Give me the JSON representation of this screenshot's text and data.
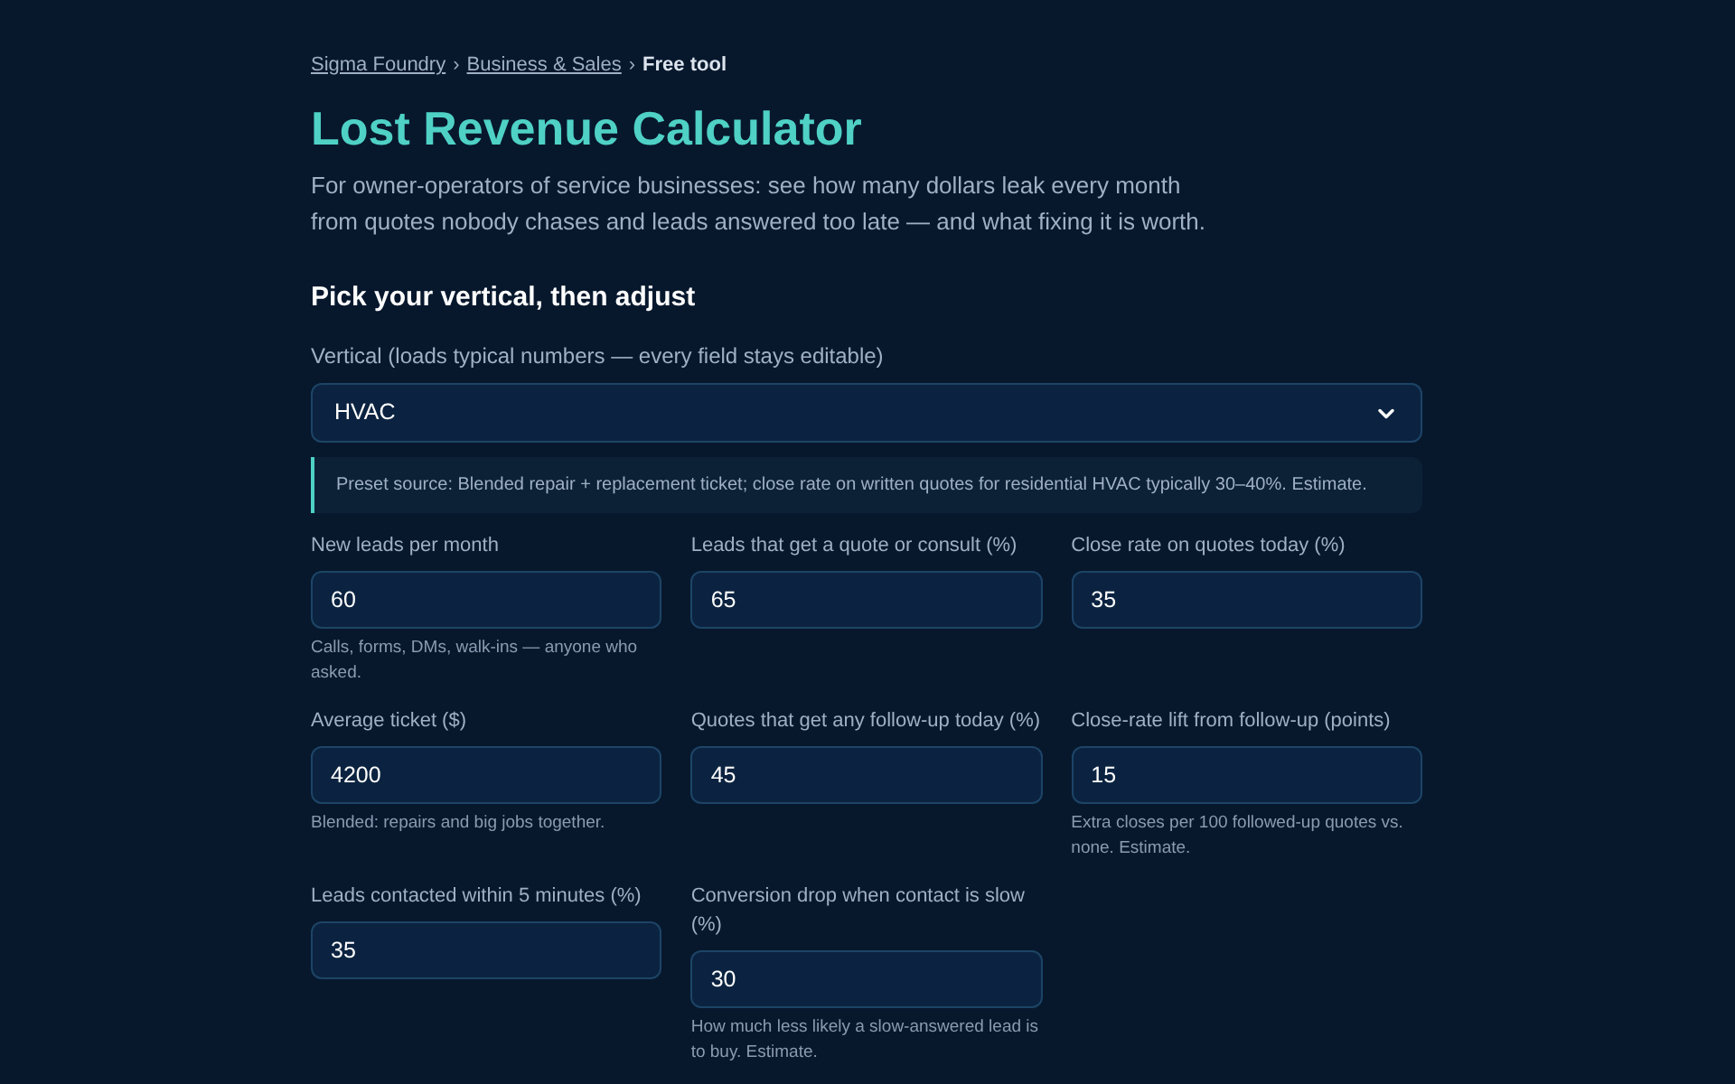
{
  "breadcrumb": [
    {
      "label": "Sigma Foundry",
      "kind": "link"
    },
    {
      "label": "Business & Sales",
      "kind": "link"
    },
    {
      "label": "Free tool",
      "kind": "current"
    }
  ],
  "separator": "›",
  "title": "Lost Revenue Calculator",
  "subtitle": "For owner-operators of service businesses: see how many dollars leak every month from quotes nobody chases and leads answered too late — and what fixing it is worth.",
  "section_heading": "Pick your vertical, then adjust",
  "vertical": {
    "label": "Vertical (loads typical numbers — every field stays editable)",
    "value": "HVAC"
  },
  "preset_note": "Preset source: Blended repair + replacement ticket; close rate on written quotes for residential HVAC typically 30–40%. Estimate.",
  "fields": [
    {
      "label": "New leads per month",
      "value": "60",
      "hint": "Calls, forms, DMs, walk-ins — anyone who asked."
    },
    {
      "label": "Leads that get a quote or consult (%)",
      "value": "65"
    },
    {
      "label": "Close rate on quotes today (%)",
      "value": "35"
    },
    {
      "label": "Average ticket ($)",
      "value": "4200",
      "hint": "Blended: repairs and big jobs together."
    },
    {
      "label": "Quotes that get any follow-up today (%)",
      "value": "45"
    },
    {
      "label": "Close-rate lift from follow-up (points)",
      "value": "15",
      "hint": "Extra closes per 100 followed-up quotes vs. none. Estimate."
    },
    {
      "label": "Leads contacted within 5 minutes (%)",
      "value": "35"
    },
    {
      "label": "Conversion drop when contact is slow (%)",
      "value": "30",
      "hint": "How much less likely a slow-answered lead is to buy. Estimate."
    }
  ]
}
